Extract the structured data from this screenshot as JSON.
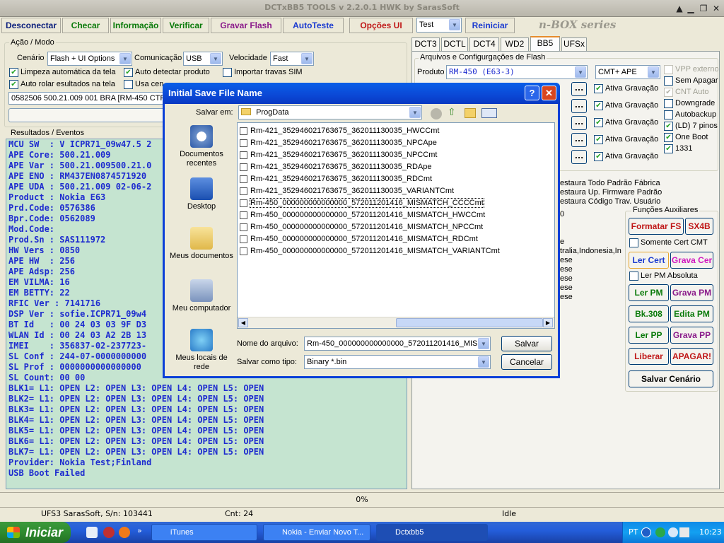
{
  "window": {
    "title": "DCTxBB5 TOOLS v 2.2.0.1 HWK by SarasSoft"
  },
  "toolbar": {
    "buttons": [
      "Desconectar",
      "Checar",
      "Informação",
      "Verificar",
      "Gravar Flash",
      "AutoTeste",
      "Opções UI"
    ],
    "test_select": "Test",
    "reiniciar": "Reiniciar",
    "brand": "n-BOX series"
  },
  "mode": {
    "group_label": "Ação / Modo",
    "scenario_label": "Cenário",
    "scenario_value": "Flash + UI Options",
    "comm_label": "Comunicação",
    "comm_value": "USB",
    "speed_label": "Velocidade",
    "speed_value": "Fast",
    "cb_clean": "Limpeza automática da tela",
    "cb_autodetect": "Auto detectar produto",
    "cb_import": "Importar travas SIM",
    "cb_autoscroll": "Auto rolar esultados na tela",
    "cb_usecen": "Usa cen",
    "product_line": "0582506 500.21.009 001 BRA [RM-450 CTR"
  },
  "results": {
    "group_label": "Resultados / Eventos",
    "lines": [
      "MCU SW  : V ICPR71_09w47.5 2",
      "APE Core: 500.21.009",
      "APE Var : 500.21.009500.21.0",
      "APE ENO : RM437EN0874571920",
      "APE UDA : 500.21.009 02-06-2",
      "Product : Nokia E63",
      "Prd.Code: 0576386",
      "Bpr.Code: 0562089",
      "Mod.Code:",
      "Prod.Sn : SAS111972",
      "HW Vers : 0850",
      "APE HW  : 256",
      "APE Adsp: 256",
      "EM VILMA: 16",
      "EM BETTY: 22",
      "RFIC Ver : 7141716",
      "DSP Ver : sofie.ICPR71_09w4",
      "BT Id   : 00 24 03 03 9F D3",
      "WLAN Id : 00 24 03 A2 2B 13",
      "IMEI    : 356837-02-237723-",
      "SL Conf : 244-07-0000000000",
      "SL Prof : 0000000000000000",
      "SL Count: 00 00",
      "BLK1= L1: OPEN L2: OPEN L3: OPEN L4: OPEN L5: OPEN",
      "BLK2= L1: OPEN L2: OPEN L3: OPEN L4: OPEN L5: OPEN",
      "BLK3= L1: OPEN L2: OPEN L3: OPEN L4: OPEN L5: OPEN",
      "BLK4= L1: OPEN L2: OPEN L3: OPEN L4: OPEN L5: OPEN",
      "BLK5= L1: OPEN L2: OPEN L3: OPEN L4: OPEN L5: OPEN",
      "BLK6= L1: OPEN L2: OPEN L3: OPEN L4: OPEN L5: OPEN",
      "BLK7= L1: OPEN L2: OPEN L3: OPEN L4: OPEN L5: OPEN",
      "Provider: Nokia Test;Finland",
      "USB Boot Failed"
    ]
  },
  "tabs": [
    "DCT3",
    "DCTL",
    "DCT4",
    "WD2",
    "BB5",
    "UFSx"
  ],
  "bb5": {
    "group_label": "Arquivos e Configurgações de Flash",
    "produto_label": "Produto",
    "produto_value": "RM-450  (E63-3)",
    "cmt_ape": "CMT+ APE",
    "ativa": "Ativa Gravação",
    "dots": "...",
    "right_cbs": [
      "VPP externo",
      "Sem Apagar",
      "CNT Auto",
      "Downgrade",
      "Autobackup",
      "(LD) 7 pinos",
      "One Boot",
      "1331"
    ],
    "restore": [
      "estaura Todo Padrão Fábrica",
      "estaura Up. Firmware Padrão",
      "estaura Código Trav. Usuário"
    ],
    "partial": [
      "e",
      "e",
      "tralia,Indonesia,In",
      "ese",
      "ese",
      "ese",
      "ese",
      "ese"
    ],
    "zero": "0"
  },
  "aux": {
    "group_label": "Funções Auxiliares",
    "formatar": "Formatar FS",
    "sx4b": "SX4B",
    "somente": "Somente Cert CMT",
    "ler_cert": "Ler Cert",
    "grava_cert": "Grava Cer",
    "ler_pm_abs": "Ler PM Absoluta",
    "ler_pm": "Ler PM",
    "grava_pm": "Grava PM",
    "bk308": "Bk.308",
    "edita_pm": "Edita PM",
    "ler_pp": "Ler PP",
    "grava_pp": "Grava PP",
    "liberar": "Liberar",
    "apagar": "APAGAR!",
    "salvar_cenario": "Salvar Cenário"
  },
  "progress": {
    "text": "0%"
  },
  "status": {
    "ufs": "UFS3 SarasSoft, S/n: 103441",
    "cnt": "Cnt: 24",
    "state": "Idle"
  },
  "dialog": {
    "title": "Initial Save File Name",
    "help": "?",
    "close": "✕",
    "save_in_label": "Salvar em:",
    "save_in_value": "ProgData",
    "places": [
      "Documentos recentes",
      "Desktop",
      "Meus documentos",
      "Meu computador",
      "Meus locais de rede"
    ],
    "files": [
      "Rm-421_352946021763675_362011130035_HWCCmt",
      "Rm-421_352946021763675_362011130035_NPCApe",
      "Rm-421_352946021763675_362011130035_NPCCmt",
      "Rm-421_352946021763675_362011130035_RDApe",
      "Rm-421_352946021763675_362011130035_RDCmt",
      "Rm-421_352946021763675_362011130035_VARIANTCmt",
      "Rm-450_000000000000000_572011201416_MISMATCH_CCCCmt",
      "Rm-450_000000000000000_572011201416_MISMATCH_HWCCmt",
      "Rm-450_000000000000000_572011201416_MISMATCH_NPCCmt",
      "Rm-450_000000000000000_572011201416_MISMATCH_RDCmt",
      "Rm-450_000000000000000_572011201416_MISMATCH_VARIANTCmt"
    ],
    "filename_label": "Nome do arquivo:",
    "filename_value": "Rm-450_000000000000000_572011201416_MIS",
    "type_label": "Salvar como tipo:",
    "type_value": "Binary *.bin",
    "save_button": "Salvar",
    "cancel_button": "Cancelar"
  },
  "taskbar": {
    "start": "Iniciar",
    "tasks": [
      "iTunes",
      "Nokia - Enviar Novo T...",
      "Dctxbb5"
    ],
    "lang": "PT",
    "clock": "10:23"
  }
}
